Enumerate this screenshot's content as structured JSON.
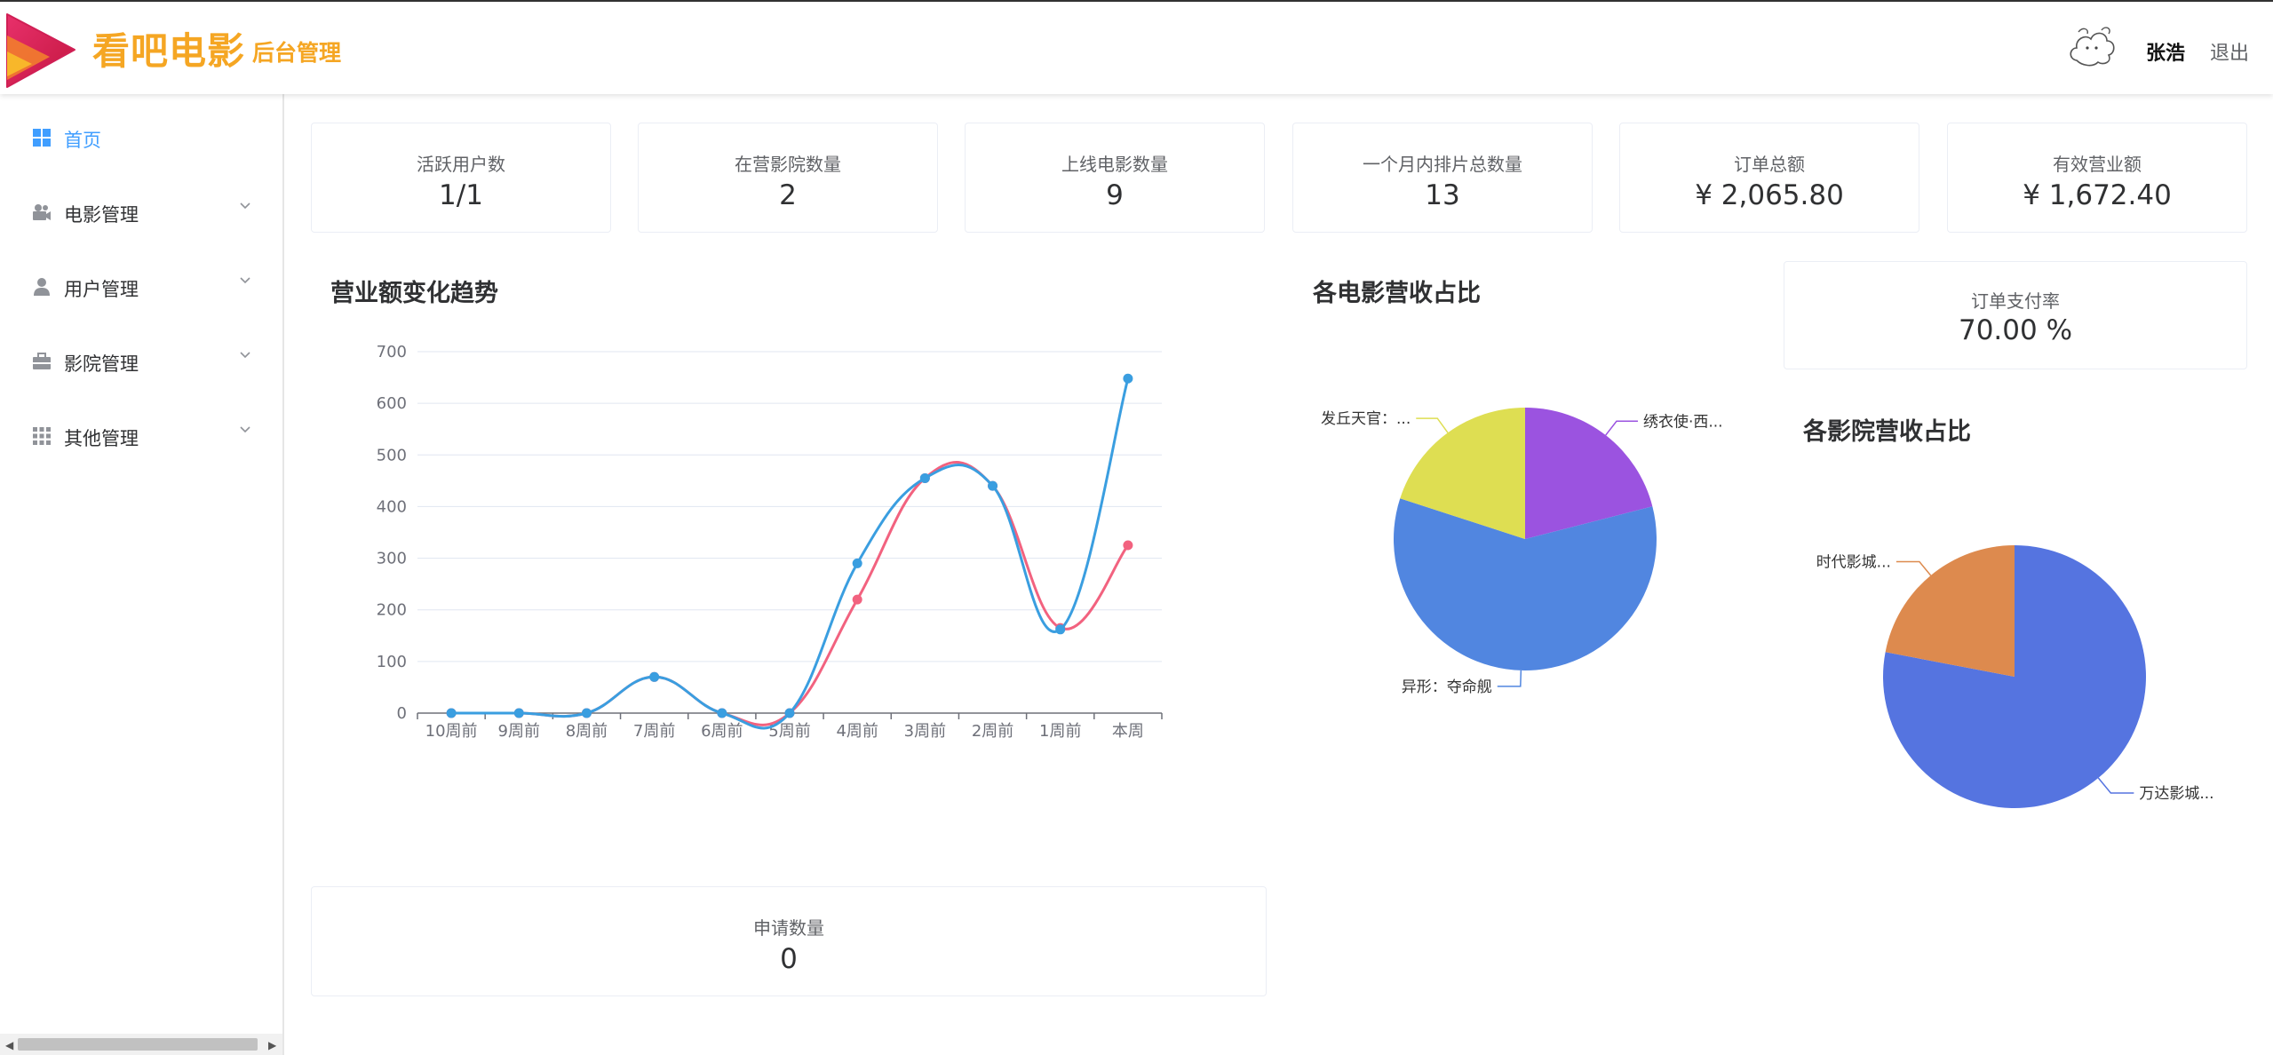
{
  "header": {
    "app_title": "看吧电影",
    "app_subtitle": "后台管理",
    "username": "张浩",
    "logout_label": "退出"
  },
  "sidebar": {
    "items": [
      {
        "label": "首页",
        "icon": "grid-icon",
        "active": true,
        "expandable": false
      },
      {
        "label": "电影管理",
        "icon": "camera-icon",
        "active": false,
        "expandable": true
      },
      {
        "label": "用户管理",
        "icon": "user-icon",
        "active": false,
        "expandable": true
      },
      {
        "label": "影院管理",
        "icon": "briefcase-icon",
        "active": false,
        "expandable": true
      },
      {
        "label": "其他管理",
        "icon": "apps-icon",
        "active": false,
        "expandable": true
      }
    ]
  },
  "stats": [
    {
      "label": "活跃用户数",
      "value": "1/1"
    },
    {
      "label": "在营影院数量",
      "value": "2"
    },
    {
      "label": "上线电影数量",
      "value": "9"
    },
    {
      "label": "一个月内排片总数量",
      "value": "13"
    },
    {
      "label": "订单总额",
      "value": "¥ 2,065.80"
    },
    {
      "label": "有效营业额",
      "value": "¥ 1,672.40"
    }
  ],
  "trend": {
    "title": "营业额变化趋势"
  },
  "movie_share": {
    "title": "各电影营收占比"
  },
  "cinema_share": {
    "title": "各影院营收占比"
  },
  "pay_rate": {
    "label": "订单支付率",
    "value": "70.00 %"
  },
  "apply": {
    "label": "申请数量",
    "value": "0"
  },
  "colors": {
    "accent": "#409eff",
    "brand": "#f5a623",
    "line_blue": "#3a9ee0",
    "line_pink": "#f2627f",
    "pie_purple": "#9b53e0",
    "pie_blue": "#5186e0",
    "pie_yellow": "#dede52",
    "pie_orange": "#dd8a4e",
    "pie_indigo": "#5574e0"
  },
  "chart_data": [
    {
      "type": "line",
      "title": "营业额变化趋势",
      "categories": [
        "10周前",
        "9周前",
        "8周前",
        "7周前",
        "6周前",
        "5周前",
        "4周前",
        "3周前",
        "2周前",
        "1周前",
        "本周"
      ],
      "series": [
        {
          "values": [
            0,
            0,
            0,
            70,
            0,
            0,
            220,
            455,
            440,
            165,
            325
          ],
          "color": "#f2627f"
        },
        {
          "values": [
            0,
            0,
            0,
            70,
            0,
            0,
            290,
            455,
            440,
            162,
            648
          ],
          "color": "#3a9ee0"
        }
      ],
      "yticks": [
        0,
        100,
        200,
        300,
        400,
        500,
        600,
        700
      ],
      "ylim": [
        0,
        700
      ],
      "smooth": true,
      "grid": true
    },
    {
      "type": "pie",
      "title": "各电影营收占比",
      "slices": [
        {
          "label": "绣衣使·西...",
          "value": 21,
          "color": "#9b53e0"
        },
        {
          "label": "异形：夺命舰",
          "value": 59,
          "color": "#5186e0"
        },
        {
          "label": "发丘天官：...",
          "value": 20,
          "color": "#dede52"
        }
      ]
    },
    {
      "type": "pie",
      "title": "各影院营收占比",
      "slices": [
        {
          "label": "万达影城...",
          "value": 78,
          "color": "#5574e0"
        },
        {
          "label": "时代影城...",
          "value": 22,
          "color": "#dd8a4e"
        }
      ]
    }
  ]
}
